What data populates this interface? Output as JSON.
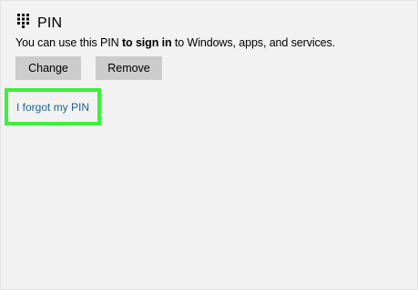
{
  "pin_section": {
    "title": "PIN",
    "icon": "keypad-icon",
    "description": {
      "part1": "You can use this PIN ",
      "bold1": "to sign in",
      "part2": " to Windows, apps, and services."
    },
    "buttons": {
      "change_label": "Change",
      "remove_label": "Remove"
    },
    "forgot_link_label": "I forgot my PIN"
  },
  "colors": {
    "background": "#f2f2f2",
    "button_bg": "#cccccc",
    "link": "#1f6490",
    "highlight": "#3cf13c"
  }
}
